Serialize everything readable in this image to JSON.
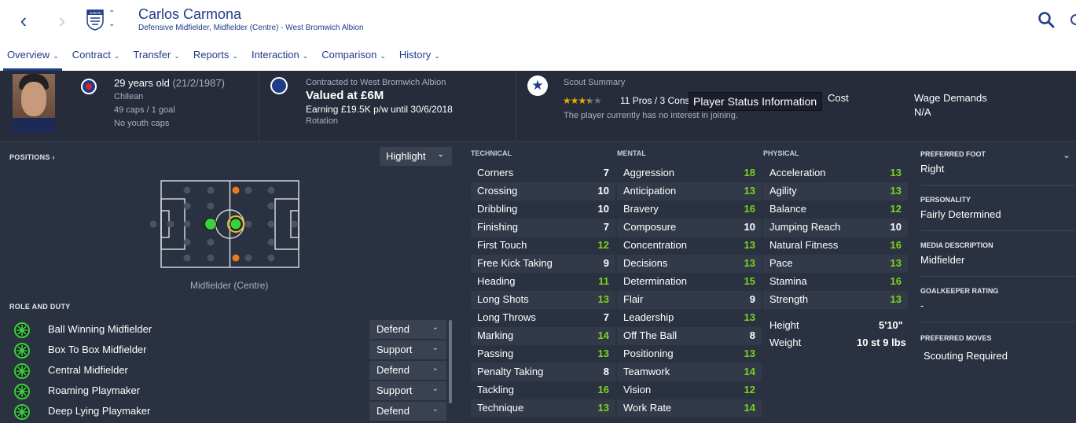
{
  "player": {
    "name": "Carlos Carmona",
    "subtitle": "Defensive Midfielder, Midfielder (Centre) - West Bromwich Albion",
    "crest_text": "ALBION"
  },
  "tabs": [
    {
      "label": "Overview"
    },
    {
      "label": "Contract"
    },
    {
      "label": "Transfer"
    },
    {
      "label": "Reports"
    },
    {
      "label": "Interaction"
    },
    {
      "label": "Comparison"
    },
    {
      "label": "History"
    }
  ],
  "header": {
    "age": "29 years old",
    "dob": "(21/2/1987)",
    "nationality": "Chilean",
    "caps": "49 caps / 1 goal",
    "youth": "No youth caps",
    "contract_label": "Contracted to West Bromwich Albion",
    "value": "Valued at £6M",
    "earning": "Earning £19.5K p/w until 30/6/2018",
    "status": "Rotation",
    "scout_title": "Scout Summary",
    "rating_stars": 3.5,
    "rating_max": 5,
    "pros_cons": "11 Pros / 3 Cons",
    "interest": "The player currently has no interest in joining.",
    "cost_label": "Cost",
    "wage_label": "Wage Demands",
    "wage_value": "N/A",
    "tooltip": "Player Status Information"
  },
  "positions": {
    "title": "POSITIONS",
    "highlight": "Highlight",
    "position_label": "Midfielder (Centre)"
  },
  "roles": {
    "title": "ROLE AND DUTY",
    "items": [
      {
        "name": "Ball Winning Midfielder",
        "duty": "Defend"
      },
      {
        "name": "Box To Box Midfielder",
        "duty": "Support"
      },
      {
        "name": "Central Midfielder",
        "duty": "Defend"
      },
      {
        "name": "Roaming Playmaker",
        "duty": "Support"
      },
      {
        "name": "Deep Lying Playmaker",
        "duty": "Defend"
      }
    ]
  },
  "technical": {
    "title": "TECHNICAL",
    "items": [
      {
        "name": "Corners",
        "value": "7"
      },
      {
        "name": "Crossing",
        "value": "10"
      },
      {
        "name": "Dribbling",
        "value": "10"
      },
      {
        "name": "Finishing",
        "value": "7"
      },
      {
        "name": "First Touch",
        "value": "12"
      },
      {
        "name": "Free Kick Taking",
        "value": "9"
      },
      {
        "name": "Heading",
        "value": "11"
      },
      {
        "name": "Long Shots",
        "value": "13"
      },
      {
        "name": "Long Throws",
        "value": "7"
      },
      {
        "name": "Marking",
        "value": "14"
      },
      {
        "name": "Passing",
        "value": "13"
      },
      {
        "name": "Penalty Taking",
        "value": "8"
      },
      {
        "name": "Tackling",
        "value": "16"
      },
      {
        "name": "Technique",
        "value": "13"
      }
    ]
  },
  "mental": {
    "title": "MENTAL",
    "items": [
      {
        "name": "Aggression",
        "value": "18"
      },
      {
        "name": "Anticipation",
        "value": "13"
      },
      {
        "name": "Bravery",
        "value": "16"
      },
      {
        "name": "Composure",
        "value": "10"
      },
      {
        "name": "Concentration",
        "value": "13"
      },
      {
        "name": "Decisions",
        "value": "13"
      },
      {
        "name": "Determination",
        "value": "15"
      },
      {
        "name": "Flair",
        "value": "9"
      },
      {
        "name": "Leadership",
        "value": "13"
      },
      {
        "name": "Off The Ball",
        "value": "8"
      },
      {
        "name": "Positioning",
        "value": "13"
      },
      {
        "name": "Teamwork",
        "value": "14"
      },
      {
        "name": "Vision",
        "value": "12"
      },
      {
        "name": "Work Rate",
        "value": "14"
      }
    ]
  },
  "physical": {
    "title": "PHYSICAL",
    "items": [
      {
        "name": "Acceleration",
        "value": "13"
      },
      {
        "name": "Agility",
        "value": "13"
      },
      {
        "name": "Balance",
        "value": "12"
      },
      {
        "name": "Jumping Reach",
        "value": "10"
      },
      {
        "name": "Natural Fitness",
        "value": "16"
      },
      {
        "name": "Pace",
        "value": "13"
      },
      {
        "name": "Stamina",
        "value": "16"
      },
      {
        "name": "Strength",
        "value": "13"
      }
    ],
    "height_label": "Height",
    "height_value": "5'10\"",
    "weight_label": "Weight",
    "weight_value": "10 st 9 lbs"
  },
  "info": {
    "foot_label": "PREFERRED FOOT",
    "foot_value": "Right",
    "personality_label": "PERSONALITY",
    "personality_value": "Fairly Determined",
    "media_label": "MEDIA DESCRIPTION",
    "media_value": "Midfielder",
    "gk_label": "GOALKEEPER RATING",
    "gk_value": "-",
    "moves_label": "PREFERRED MOVES",
    "moves_value": "Scouting Required"
  },
  "colors": {
    "attr_low": "#ffffff",
    "attr_good": "#7ed321",
    "accent": "#1f3c88"
  }
}
